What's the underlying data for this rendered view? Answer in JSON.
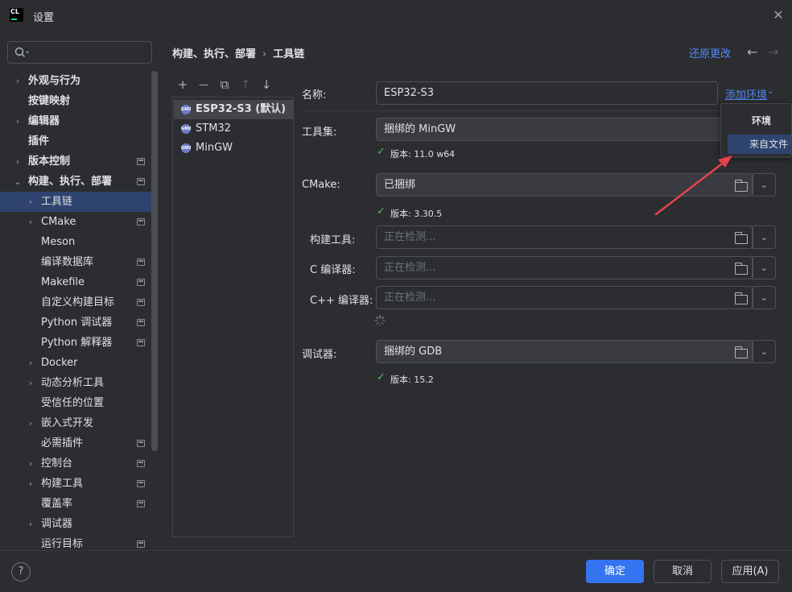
{
  "window": {
    "title": "设置",
    "logo_text": "CL"
  },
  "search": {
    "placeholder": ""
  },
  "sidebar": {
    "items": [
      {
        "label": "外观与行为",
        "chevron": "›",
        "bold": true
      },
      {
        "label": "按键映射",
        "chevron": "",
        "bold": true
      },
      {
        "label": "编辑器",
        "chevron": "›",
        "bold": true
      },
      {
        "label": "插件",
        "chevron": "",
        "bold": true
      },
      {
        "label": "版本控制",
        "chevron": "›",
        "bold": true
      },
      {
        "label": "构建、执行、部署",
        "chevron": "⌄",
        "bold": true
      },
      {
        "label": "工具链",
        "chevron": "›"
      },
      {
        "label": "CMake",
        "chevron": "›"
      },
      {
        "label": "Meson",
        "chevron": ""
      },
      {
        "label": "编译数据库",
        "chevron": ""
      },
      {
        "label": "Makefile",
        "chevron": ""
      },
      {
        "label": "自定义构建目标",
        "chevron": ""
      },
      {
        "label": "Python 调试器",
        "chevron": ""
      },
      {
        "label": "Python 解释器",
        "chevron": ""
      },
      {
        "label": "Docker",
        "chevron": "›"
      },
      {
        "label": "动态分析工具",
        "chevron": "›"
      },
      {
        "label": "受信任的位置",
        "chevron": ""
      },
      {
        "label": "嵌入式开发",
        "chevron": "›"
      },
      {
        "label": "必需插件",
        "chevron": ""
      },
      {
        "label": "控制台",
        "chevron": "›"
      },
      {
        "label": "构建工具",
        "chevron": "›"
      },
      {
        "label": "覆盖率",
        "chevron": ""
      },
      {
        "label": "调试器",
        "chevron": "›"
      },
      {
        "label": "运行目标",
        "chevron": ""
      }
    ]
  },
  "header": {
    "breadcrumb_parent": "构建、执行、部署",
    "breadcrumb_sep": "›",
    "breadcrumb_current": "工具链",
    "reset_label": "还原更改",
    "back_icon": "←",
    "forward_icon": "→"
  },
  "toolbar": {
    "add": "+",
    "remove": "—",
    "copy": "⧉",
    "up": "↑",
    "down": "↓"
  },
  "toolchains": [
    {
      "name": "ESP32-S3 (默认)",
      "badge": "GNU"
    },
    {
      "name": "STM32",
      "badge": "GNU"
    },
    {
      "name": "MinGW",
      "badge": "GNU"
    }
  ],
  "form": {
    "name_label": "名称:",
    "name_value": "ESP32-S3",
    "add_env_label": "添加环境",
    "add_env_chevron": "⌄",
    "toolset_label": "工具集:",
    "toolset_value": "捆绑的 MinGW",
    "toolset_version": "版本: 11.0 w64",
    "cmake_label": "CMake:",
    "cmake_value": "已捆绑",
    "cmake_version": "版本: 3.30.5",
    "build_tool_label": "构建工具:",
    "build_tool_placeholder": "正在检测...",
    "c_compiler_label": "C 编译器:",
    "c_compiler_placeholder": "正在检测...",
    "cpp_compiler_label": "C++ 编译器:",
    "cpp_compiler_placeholder": "正在检测...",
    "debugger_label": "调试器:",
    "debugger_value": "捆绑的 GDB",
    "debugger_version": "版本: 15.2",
    "check": "✓",
    "dropdown_chevron": "⌄"
  },
  "popup": {
    "header": "环境",
    "item": "来自文件"
  },
  "footer": {
    "help": "?",
    "ok": "确定",
    "cancel": "取消",
    "apply": "应用(A)"
  },
  "colors": {
    "accent": "#3574f0",
    "link": "#548af7",
    "selection": "#2e436e",
    "success": "#5fb865",
    "annotation": "#e8424e"
  }
}
